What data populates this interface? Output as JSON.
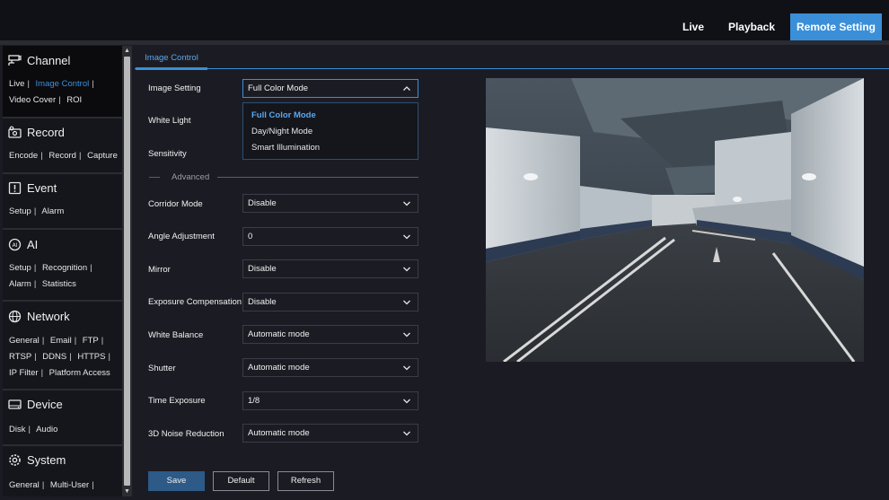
{
  "topnav": {
    "live": "Live",
    "playback": "Playback",
    "remote_setting": "Remote Setting"
  },
  "sidebar": {
    "channel": {
      "title": "Channel",
      "links": [
        "Live",
        "Image Control",
        "Video Cover",
        "ROI"
      ]
    },
    "record": {
      "title": "Record",
      "links": [
        "Encode",
        "Record",
        "Capture"
      ]
    },
    "event": {
      "title": "Event",
      "links": [
        "Setup",
        "Alarm"
      ]
    },
    "ai": {
      "title": "AI",
      "links": [
        "Setup",
        "Recognition",
        "Alarm",
        "Statistics"
      ]
    },
    "network": {
      "title": "Network",
      "links": [
        "General",
        "Email",
        "FTP",
        "RTSP",
        "DDNS",
        "HTTPS",
        "IP Filter",
        "Platform Access"
      ]
    },
    "device": {
      "title": "Device",
      "links": [
        "Disk",
        "Audio"
      ]
    },
    "system": {
      "title": "System",
      "links": [
        "General",
        "Multi-User"
      ]
    }
  },
  "tab": {
    "label": "Image Control"
  },
  "form": {
    "image_setting": {
      "label": "Image Setting",
      "value": "Full Color Mode"
    },
    "white_light": {
      "label": "White Light"
    },
    "sensitivity": {
      "label": "Sensitivity"
    },
    "dropdown_options": [
      "Full Color Mode",
      "Day/Night Mode",
      "Smart Illumination"
    ],
    "advanced": "Advanced",
    "corridor_mode": {
      "label": "Corridor Mode",
      "value": "Disable"
    },
    "angle_adjustment": {
      "label": "Angle Adjustment",
      "value": "0"
    },
    "mirror": {
      "label": "Mirror",
      "value": "Disable"
    },
    "exposure_compensation": {
      "label": "Exposure Compensation",
      "value": "Disable"
    },
    "white_balance": {
      "label": "White Balance",
      "value": "Automatic mode"
    },
    "shutter": {
      "label": "Shutter",
      "value": "Automatic mode"
    },
    "time_exposure": {
      "label": "Time Exposure",
      "value": "1/8"
    },
    "noise_reduction": {
      "label": "3D Noise Reduction",
      "value": "Automatic mode"
    }
  },
  "buttons": {
    "save": "Save",
    "default": "Default",
    "refresh": "Refresh"
  },
  "colors": {
    "accent": "#3b8fd8",
    "background": "#1b1c23"
  }
}
